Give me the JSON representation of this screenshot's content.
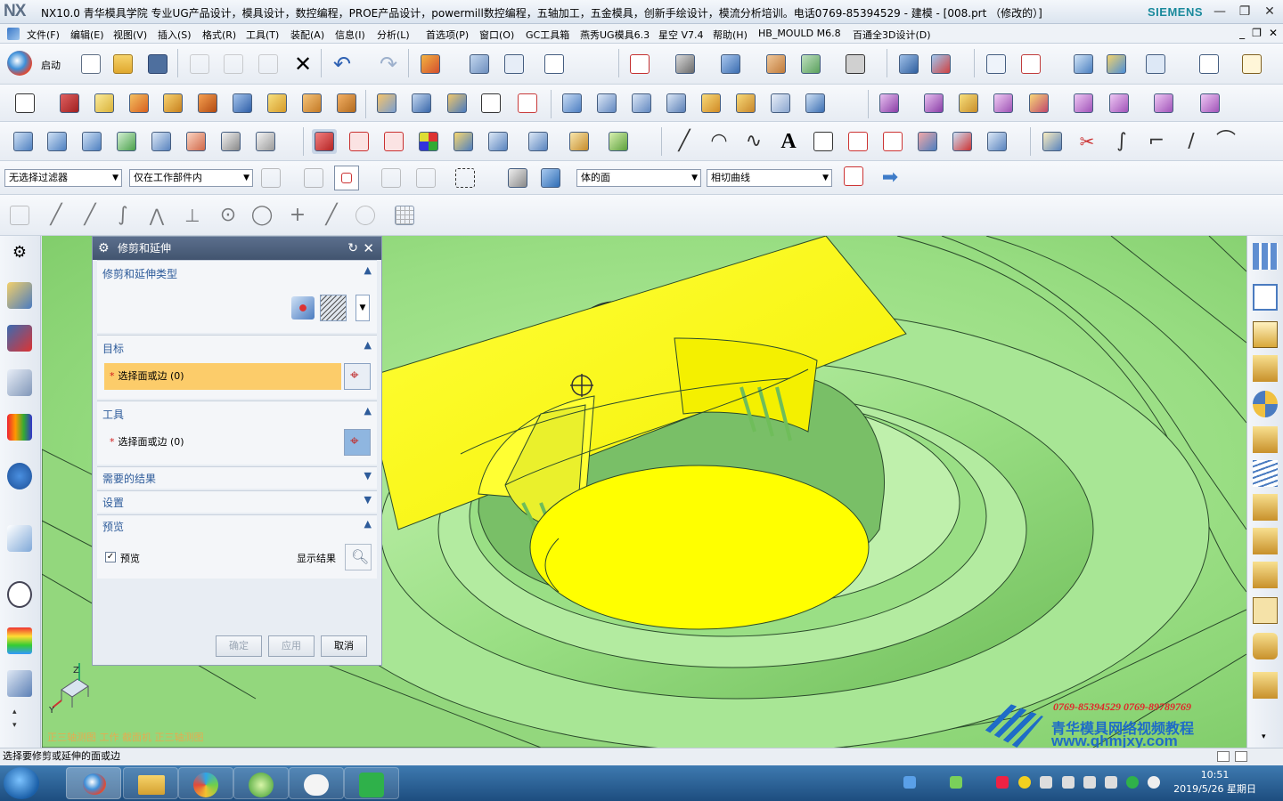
{
  "title": {
    "logo": "NX",
    "text": "NX10.0 青华模具学院 专业UG产品设计，模具设计，数控编程，PROE产品设计，powermill数控编程，五轴加工，五金模具，创新手绘设计，模流分析培训。电话0769-85394529 - 建模 - [008.prt （修改的）]",
    "brand": "SIEMENS",
    "minimize": "—",
    "restore": "❐",
    "close": "✕"
  },
  "menu": {
    "items": [
      "文件(F)",
      "编辑(E)",
      "视图(V)",
      "插入(S)",
      "格式(R)",
      "工具(T)",
      "装配(A)",
      "信息(I)",
      "分析(L)",
      "首选项(P)",
      "窗口(O)",
      "GC工具箱",
      "燕秀UG模具6.3",
      "星空 V7.4",
      "帮助(H)",
      "HB_MOULD M6.8",
      "百通全3D设计(D)"
    ],
    "right_min": "_",
    "right_restore": "❐",
    "right_close": "✕"
  },
  "toolbar": {
    "start_label": "启动",
    "filter_dropdown": "无选择过滤器",
    "scope_dropdown": "仅在工作部件内",
    "face_rule": "体的面",
    "curve_rule": "相切曲线"
  },
  "dialog": {
    "title": "修剪和延伸",
    "sections": {
      "type": "修剪和延伸类型",
      "target": "目标",
      "tool": "工具",
      "result": "需要的结果",
      "settings": "设置",
      "preview": "预览"
    },
    "target_select": "选择面或边 (0)",
    "tool_select": "选择面或边 (0)",
    "preview_checkbox": "预览",
    "preview_checked": true,
    "show_result": "显示结果",
    "ok": "确定",
    "apply": "应用",
    "cancel": "取消"
  },
  "viewport": {
    "triad_z": "Z",
    "triad_y": "Y",
    "view_label": "正三轴测图  工作  截面机  正三轴测图",
    "model_color": "#8dd47a",
    "highlight_color": "#ffff00"
  },
  "watermark": {
    "phones": "0769-85394529   0769-89789769",
    "name": "青华模具网络视频教程",
    "url": "www.qhmjxy.com"
  },
  "status": {
    "prompt": "选择要修剪或延伸的面或边"
  },
  "taskbar": {
    "time": "10:51",
    "date": "2019/5/26 星期日"
  }
}
